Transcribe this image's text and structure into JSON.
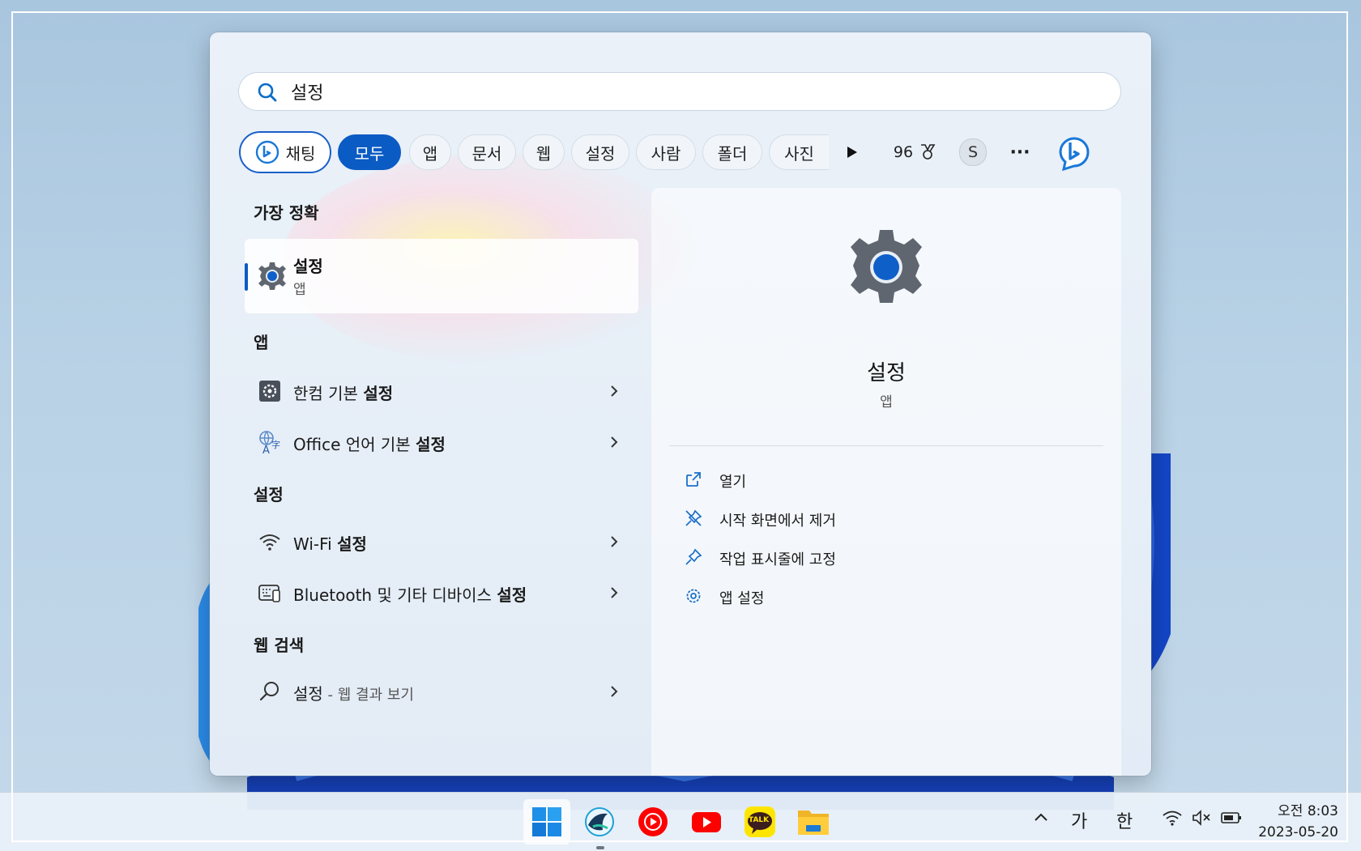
{
  "search": {
    "query": "설정"
  },
  "chips": {
    "chat": "채팅",
    "items": [
      "모두",
      "앱",
      "문서",
      "웹",
      "설정",
      "사람",
      "폴더",
      "사진"
    ],
    "score": "96",
    "avatar": "S",
    "more": "···"
  },
  "left": {
    "best_header": "가장 정확",
    "best": {
      "title": "설정",
      "subtitle": "앱"
    },
    "apps_header": "앱",
    "apps": [
      {
        "label": "한컴 기본 ",
        "bold": "설정"
      },
      {
        "label": "Office 언어 기본 ",
        "bold": "설정"
      }
    ],
    "settings_header": "설정",
    "settings": [
      {
        "label": "Wi-Fi ",
        "bold": "설정"
      },
      {
        "label": "Bluetooth 및 기타 디바이스 ",
        "bold": "설정"
      }
    ],
    "web_header": "웹 검색",
    "web": {
      "label": "설정",
      "suffix": " - 웹 결과 보기"
    }
  },
  "right": {
    "title": "설정",
    "subtitle": "앱",
    "actions": [
      "열기",
      "시작 화면에서 제거",
      "작업 표시줄에 고정",
      "앱 설정"
    ]
  },
  "taskbar": {
    "tray": {
      "caret": "^",
      "ime_ga": "가",
      "ime_han": "한"
    },
    "clock": {
      "time": "오전 8:03",
      "date": "2023-05-20"
    },
    "apps": [
      "start-icon",
      "whale-browser-icon",
      "youtube-music-icon",
      "youtube-icon",
      "kakaotalk-icon",
      "file-explorer-icon"
    ],
    "kakao_label": "TALK"
  },
  "colors": {
    "accent": "#0a5bc4",
    "panel": "#e8eff7",
    "taskbar": "#e8f0f8"
  }
}
